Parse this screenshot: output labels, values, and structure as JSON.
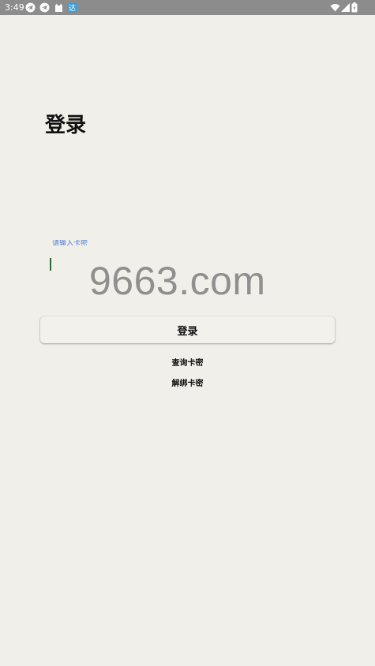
{
  "status_bar": {
    "time": "3:49",
    "icons": [
      "telegram-icon",
      "telegram-icon",
      "cat-icon",
      "app-icon",
      "wifi-icon",
      "signal-icon",
      "battery-icon"
    ]
  },
  "page": {
    "title": "登录"
  },
  "form": {
    "field_label": "请输入卡密",
    "watermark": "9663.com",
    "login_button_label": "登录"
  },
  "links": {
    "query_card": "查询卡密",
    "unbind_card": "解绑卡密"
  },
  "colors": {
    "background": "#f0efe9",
    "status_bar": "#8c8c8c",
    "accent": "#4a7fd6"
  }
}
